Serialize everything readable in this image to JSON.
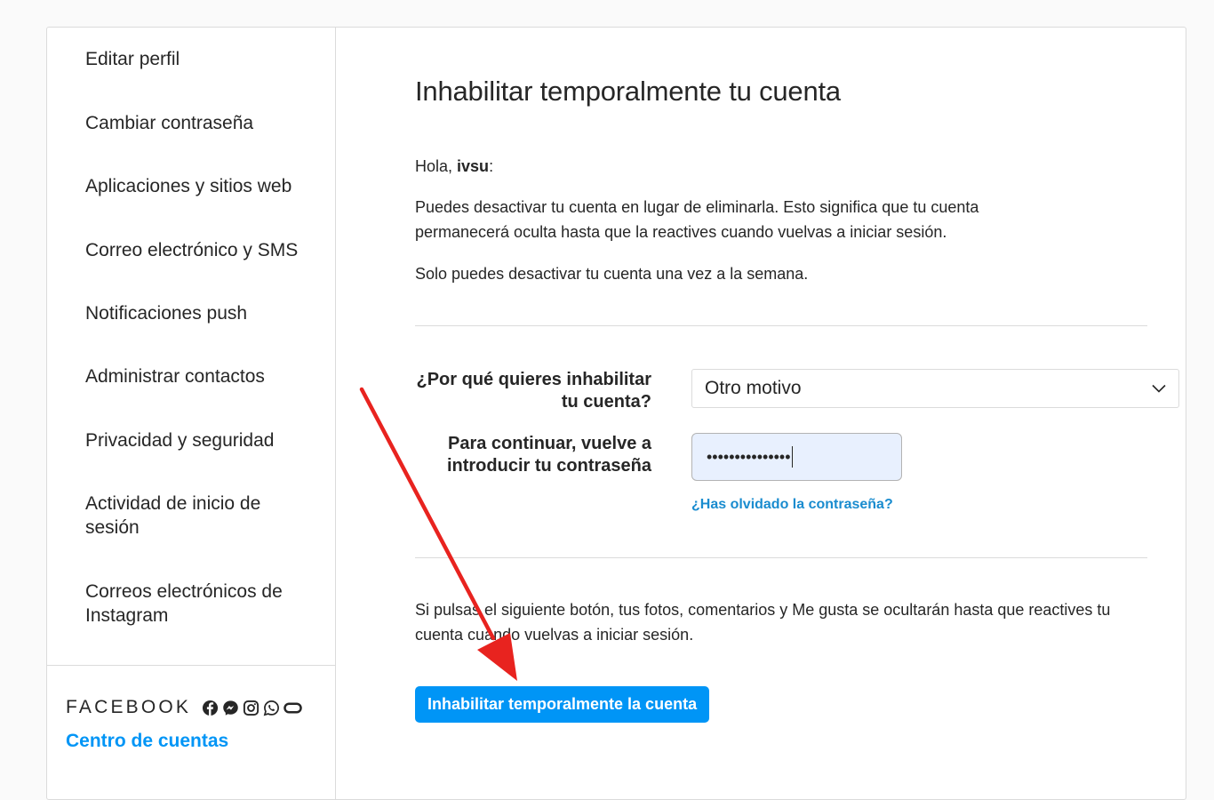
{
  "sidebar": {
    "items": [
      {
        "label": "Editar perfil"
      },
      {
        "label": "Cambiar contraseña"
      },
      {
        "label": "Aplicaciones y sitios web"
      },
      {
        "label": "Correo electrónico y SMS"
      },
      {
        "label": "Notificaciones push"
      },
      {
        "label": "Administrar contactos"
      },
      {
        "label": "Privacidad y seguridad"
      },
      {
        "label": "Actividad de inicio de sesión"
      },
      {
        "label": "Correos electrónicos de Instagram"
      }
    ],
    "brand": "FACEBOOK",
    "brand_icons": [
      "facebook-icon",
      "messenger-icon",
      "instagram-icon",
      "whatsapp-icon",
      "oculus-icon"
    ],
    "accounts_center": "Centro de cuentas"
  },
  "main": {
    "title": "Inhabilitar temporalmente tu cuenta",
    "greeting_prefix": "Hola, ",
    "username": "ivsu",
    "greeting_suffix": ":",
    "paragraph1": "Puedes desactivar tu cuenta en lugar de eliminarla. Esto significa que tu cuenta permanecerá oculta hasta que la reactives cuando vuelvas a iniciar sesión.",
    "paragraph2": "Solo puedes desactivar tu cuenta una vez a la semana.",
    "reason_label": "¿Por qué quieres inhabilitar tu cuenta?",
    "reason_value": "Otro motivo",
    "password_label": "Para continuar, vuelve a introducir tu contraseña",
    "password_value": "•••••••••••••••",
    "forgot_link": "¿Has olvidado la contraseña?",
    "warning": "Si pulsas el siguiente botón, tus fotos, comentarios y Me gusta se ocultarán hasta que reactives tu cuenta cuando vuelvas a iniciar sesión.",
    "submit_label": "Inhabilitar temporalmente la cuenta"
  },
  "colors": {
    "accent": "#0095f6",
    "link": "#1a8ccf",
    "annotation_arrow": "#e8231f",
    "password_bg": "#e8f0fe"
  }
}
